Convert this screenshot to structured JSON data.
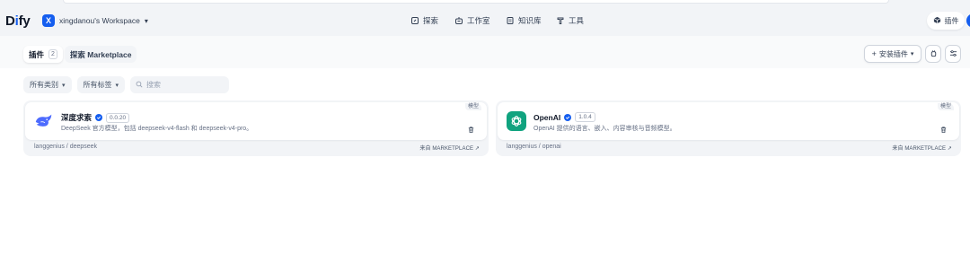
{
  "brand": {
    "logo_left": "D",
    "logo_i": "i",
    "logo_right": "fy"
  },
  "workspace": {
    "initial": "X",
    "name": "xingdanou's Workspace"
  },
  "nav": [
    {
      "label": "探索",
      "icon": "explore-icon"
    },
    {
      "label": "工作室",
      "icon": "studio-icon"
    },
    {
      "label": "知识库",
      "icon": "knowledge-icon"
    },
    {
      "label": "工具",
      "icon": "tools-icon"
    }
  ],
  "header_plugins_label": "插件",
  "tabs": {
    "plugins_label": "插件",
    "plugins_count": "2",
    "marketplace_label": "探索 Marketplace"
  },
  "toolbar": {
    "install_label": "安装插件"
  },
  "filters": {
    "category_label": "所有类别",
    "tags_label": "所有标签",
    "search_placeholder": "搜索"
  },
  "plugins": [
    {
      "name": "深度求索",
      "version": "0.0.20",
      "description": "DeepSeek 官方模型，包括 deepseek-v4-flash 和 deepseek-v4-pro。",
      "type": "模型",
      "source": "langgenius / deepseek",
      "origin": "来自 MARKETPLACE ↗",
      "icon": "deepseek-whale-icon",
      "icon_color": "#4d6bfe"
    },
    {
      "name": "OpenAI",
      "version": "1.0.4",
      "description": "OpenAI 提供的语言、嵌入、内容审核与音频模型。",
      "type": "模型",
      "source": "langgenius / openai",
      "origin": "来自 MARKETPLACE ↗",
      "icon": "openai-logo-icon",
      "icon_color": "#10a37f"
    }
  ],
  "colors": {
    "accent": "#155eef",
    "openai": "#10a37f",
    "deepseek": "#4d6bfe"
  }
}
